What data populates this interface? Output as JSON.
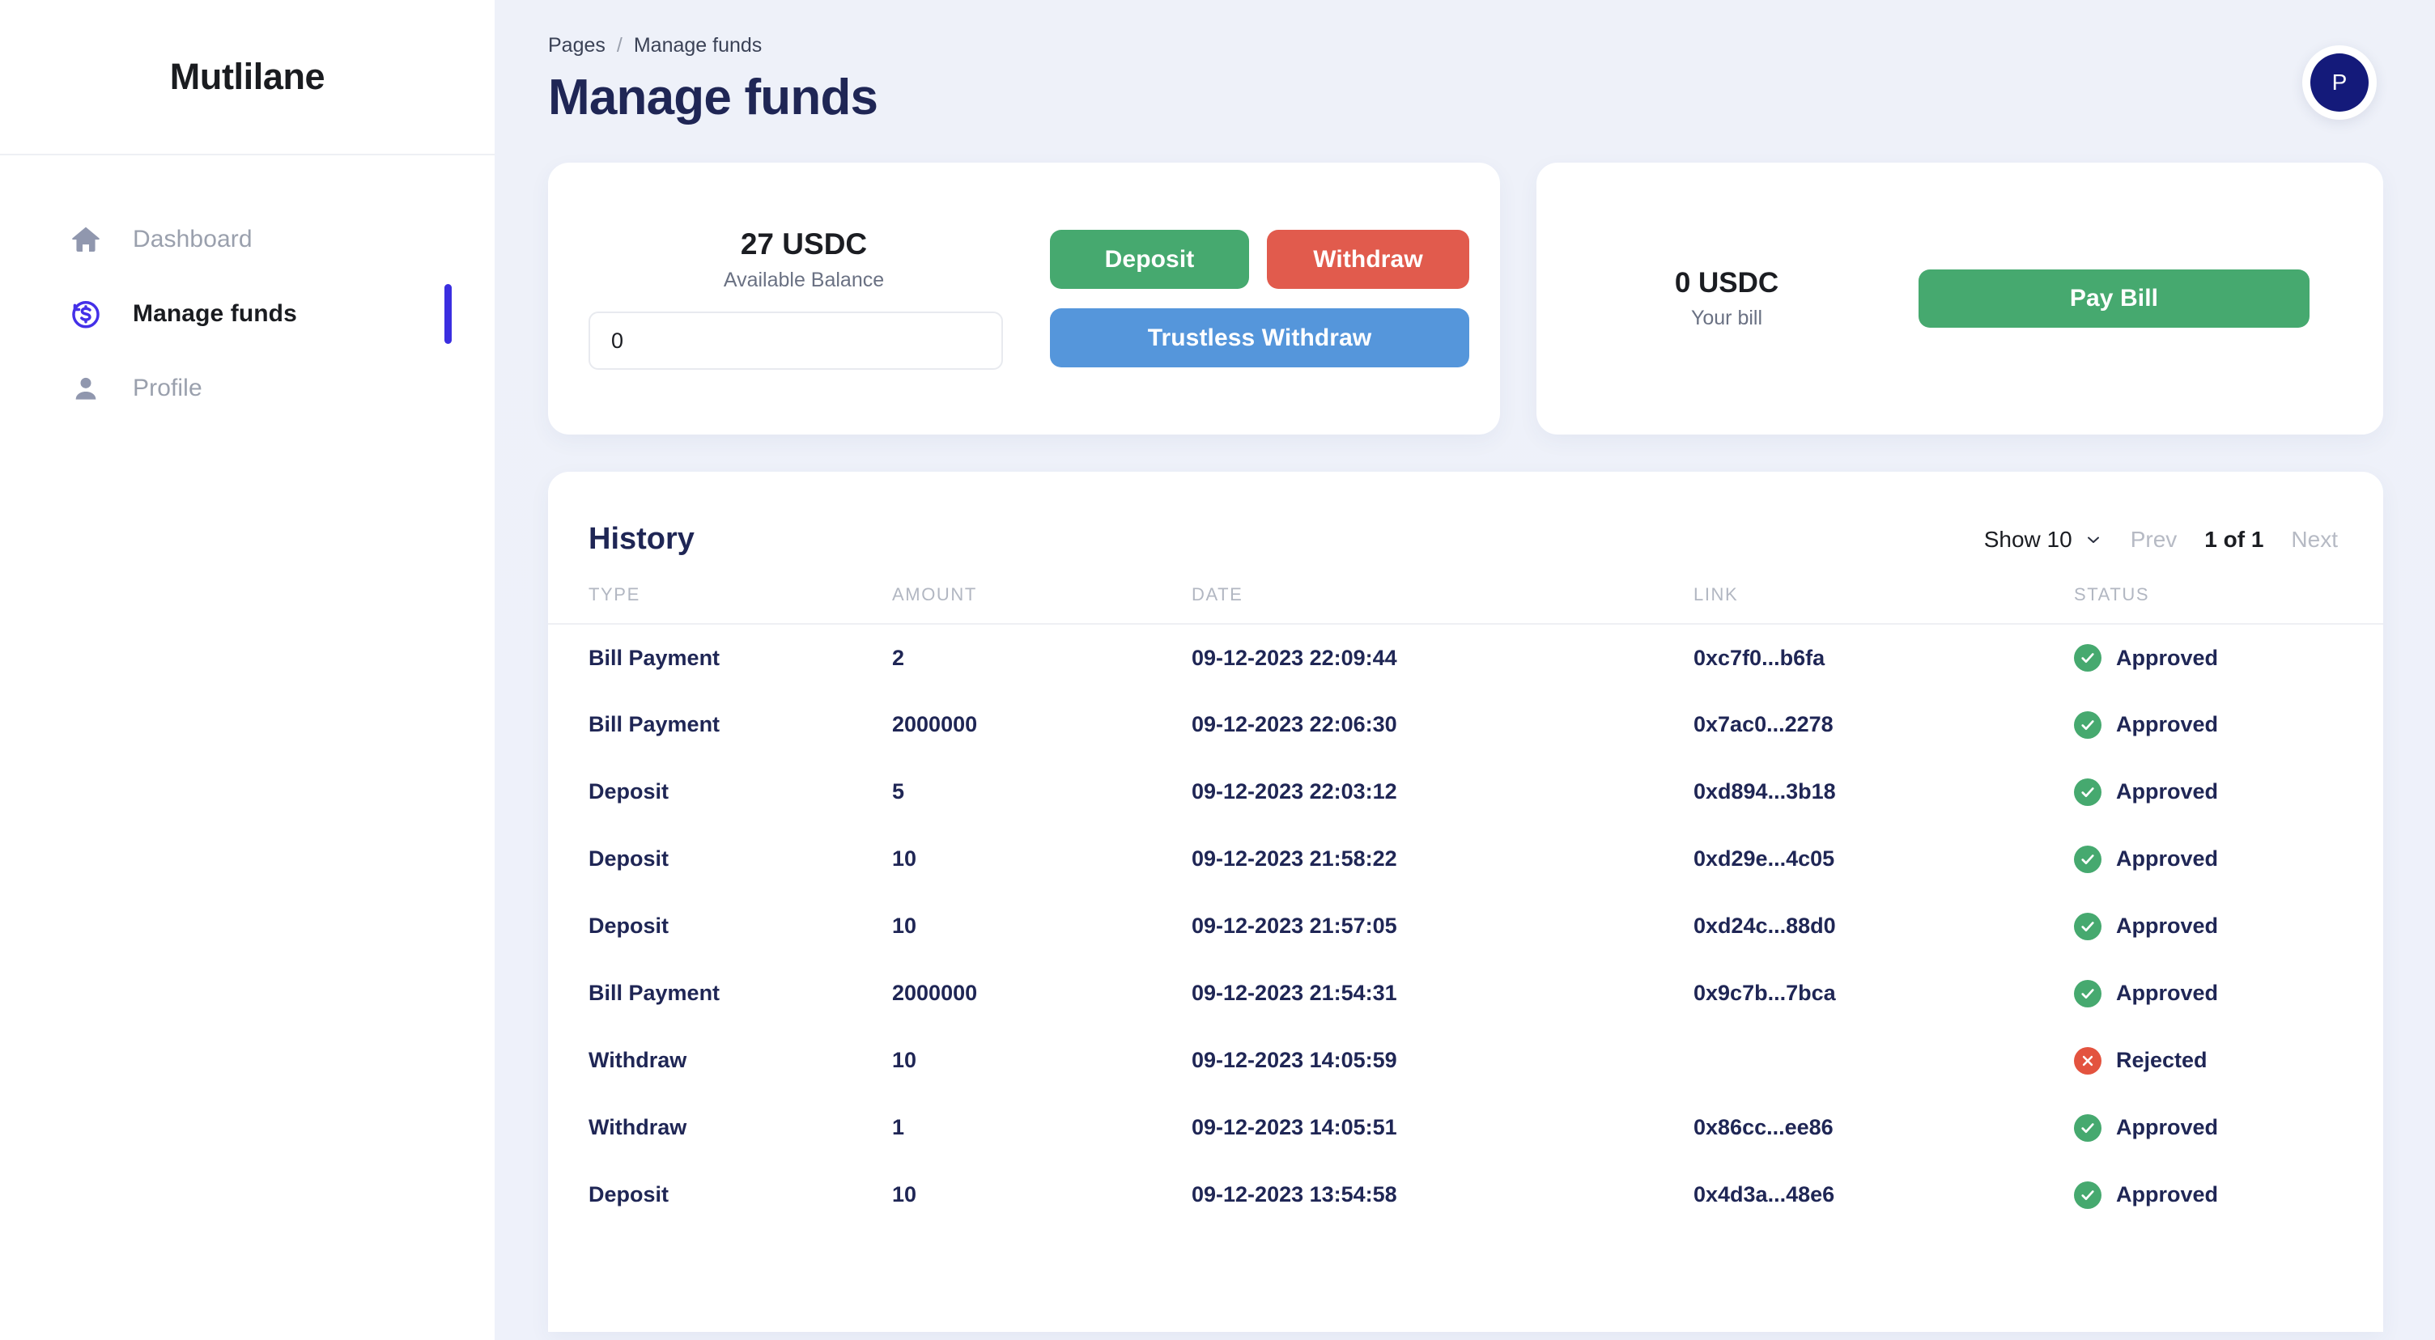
{
  "sidebar": {
    "brand": "Mutlilane",
    "items": [
      {
        "label": "Dashboard",
        "icon": "home-icon",
        "active": false
      },
      {
        "label": "Manage funds",
        "icon": "dollar-circle-icon",
        "active": true
      },
      {
        "label": "Profile",
        "icon": "person-icon",
        "active": false
      }
    ]
  },
  "header": {
    "breadcrumb_root": "Pages",
    "breadcrumb_sep": "/",
    "breadcrumb_current": "Manage funds",
    "title": "Manage funds",
    "avatar_initial": "P"
  },
  "balance_card": {
    "amount": "27 USDC",
    "label": "Available Balance",
    "input_value": "0",
    "input_placeholder": "0",
    "deposit_label": "Deposit",
    "withdraw_label": "Withdraw",
    "trustless_label": "Trustless Withdraw"
  },
  "bill_card": {
    "amount": "0 USDC",
    "label": "Your bill",
    "pay_label": "Pay Bill"
  },
  "history": {
    "title": "History",
    "show_label": "Show 10",
    "prev_label": "Prev",
    "page_label": "1 of 1",
    "next_label": "Next",
    "columns": [
      "TYPE",
      "AMOUNT",
      "DATE",
      "LINK",
      "STATUS"
    ],
    "rows": [
      {
        "type": "Bill Payment",
        "amount": "2",
        "date": "09-12-2023 22:09:44",
        "link": "0xc7f0...b6fa",
        "status": "Approved",
        "status_kind": "ok"
      },
      {
        "type": "Bill Payment",
        "amount": "2000000",
        "date": "09-12-2023 22:06:30",
        "link": "0x7ac0...2278",
        "status": "Approved",
        "status_kind": "ok"
      },
      {
        "type": "Deposit",
        "amount": "5",
        "date": "09-12-2023 22:03:12",
        "link": "0xd894...3b18",
        "status": "Approved",
        "status_kind": "ok"
      },
      {
        "type": "Deposit",
        "amount": "10",
        "date": "09-12-2023 21:58:22",
        "link": "0xd29e...4c05",
        "status": "Approved",
        "status_kind": "ok"
      },
      {
        "type": "Deposit",
        "amount": "10",
        "date": "09-12-2023 21:57:05",
        "link": "0xd24c...88d0",
        "status": "Approved",
        "status_kind": "ok"
      },
      {
        "type": "Bill Payment",
        "amount": "2000000",
        "date": "09-12-2023 21:54:31",
        "link": "0x9c7b...7bca",
        "status": "Approved",
        "status_kind": "ok"
      },
      {
        "type": "Withdraw",
        "amount": "10",
        "date": "09-12-2023 14:05:59",
        "link": "",
        "status": "Rejected",
        "status_kind": "bad"
      },
      {
        "type": "Withdraw",
        "amount": "1",
        "date": "09-12-2023 14:05:51",
        "link": "0x86cc...ee86",
        "status": "Approved",
        "status_kind": "ok"
      },
      {
        "type": "Deposit",
        "amount": "10",
        "date": "09-12-2023 13:54:58",
        "link": "0x4d3a...48e6",
        "status": "Approved",
        "status_kind": "ok"
      }
    ]
  },
  "colors": {
    "accent": "#3a2ee0",
    "green": "#46a96f",
    "red": "#e15b4d",
    "blue": "#5596db",
    "title": "#1f2655",
    "page_bg": "#eef1fa"
  }
}
